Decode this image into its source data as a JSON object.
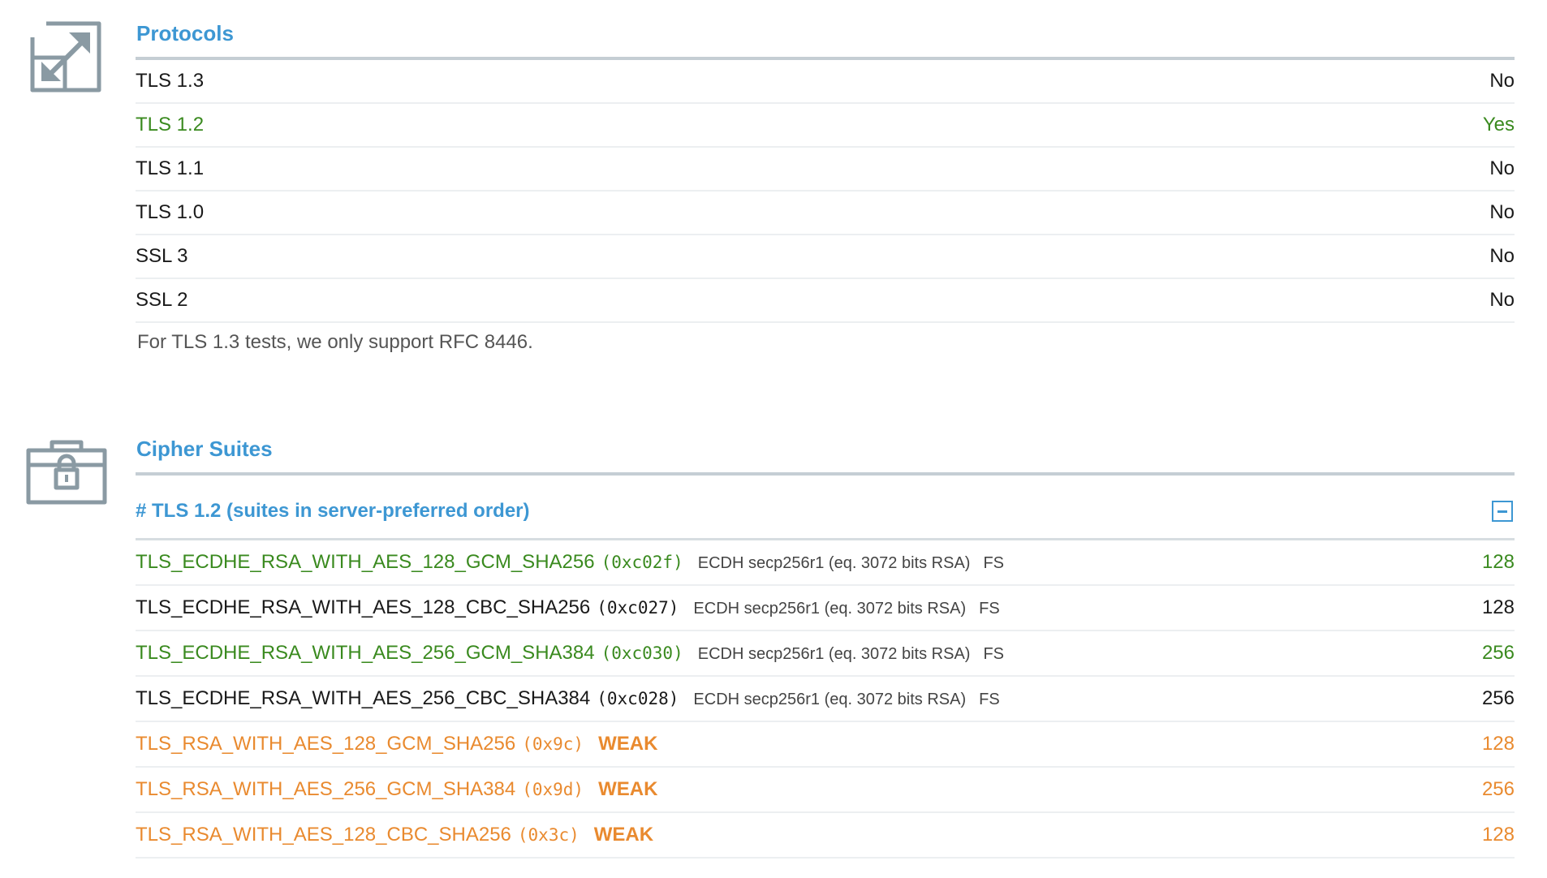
{
  "protocols": {
    "title": "Protocols",
    "rows": [
      {
        "name": "TLS 1.3",
        "value": "No",
        "supported": false
      },
      {
        "name": "TLS 1.2",
        "value": "Yes",
        "supported": true
      },
      {
        "name": "TLS 1.1",
        "value": "No",
        "supported": false
      },
      {
        "name": "TLS 1.0",
        "value": "No",
        "supported": false
      },
      {
        "name": "SSL 3",
        "value": "No",
        "supported": false
      },
      {
        "name": "SSL 2",
        "value": "No",
        "supported": false
      }
    ],
    "note": "For TLS 1.3 tests, we only support RFC 8446."
  },
  "cipher_suites": {
    "title": "Cipher Suites",
    "group_header": "# TLS 1.2 (suites in server-preferred order)",
    "suites": [
      {
        "name": "TLS_ECDHE_RSA_WITH_AES_128_GCM_SHA256",
        "hex": "(0xc02f)",
        "kex": "ECDH secp256r1 (eq. 3072 bits RSA)",
        "fs": "FS",
        "weak": "",
        "bits": "128",
        "status": "good"
      },
      {
        "name": "TLS_ECDHE_RSA_WITH_AES_128_CBC_SHA256",
        "hex": "(0xc027)",
        "kex": "ECDH secp256r1 (eq. 3072 bits RSA)",
        "fs": "FS",
        "weak": "",
        "bits": "128",
        "status": "normal"
      },
      {
        "name": "TLS_ECDHE_RSA_WITH_AES_256_GCM_SHA384",
        "hex": "(0xc030)",
        "kex": "ECDH secp256r1 (eq. 3072 bits RSA)",
        "fs": "FS",
        "weak": "",
        "bits": "256",
        "status": "good"
      },
      {
        "name": "TLS_ECDHE_RSA_WITH_AES_256_CBC_SHA384",
        "hex": "(0xc028)",
        "kex": "ECDH secp256r1 (eq. 3072 bits RSA)",
        "fs": "FS",
        "weak": "",
        "bits": "256",
        "status": "normal"
      },
      {
        "name": "TLS_RSA_WITH_AES_128_GCM_SHA256",
        "hex": "(0x9c)",
        "kex": "",
        "fs": "",
        "weak": "WEAK",
        "bits": "128",
        "status": "weak"
      },
      {
        "name": "TLS_RSA_WITH_AES_256_GCM_SHA384",
        "hex": "(0x9d)",
        "kex": "",
        "fs": "",
        "weak": "WEAK",
        "bits": "256",
        "status": "weak"
      },
      {
        "name": "TLS_RSA_WITH_AES_128_CBC_SHA256",
        "hex": "(0x3c)",
        "kex": "",
        "fs": "",
        "weak": "WEAK",
        "bits": "128",
        "status": "weak"
      }
    ]
  },
  "icons": {
    "protocols": "expand-arrows-icon",
    "cipher_suites": "locked-briefcase-icon",
    "collapse": "minus-square-icon"
  },
  "colors": {
    "accent": "#3d97d3",
    "good": "#3a8a1f",
    "weak": "#e98a2f",
    "icon": "#8a9aa3"
  }
}
